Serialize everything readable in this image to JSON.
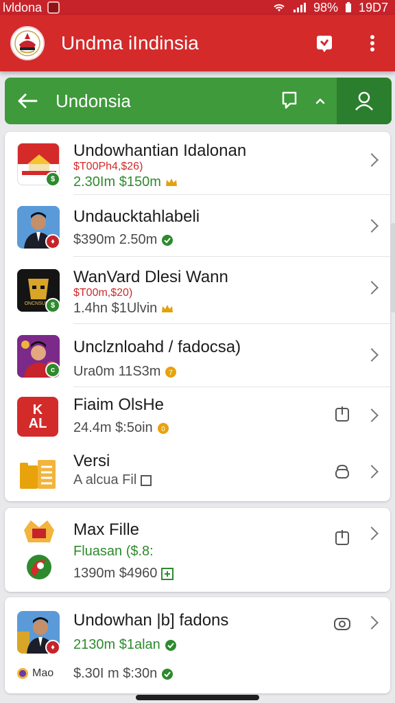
{
  "status": {
    "carrier": "lvldona",
    "battery": "98%",
    "time": "19D7"
  },
  "appbar": {
    "title": "Undma iIndinsia",
    "logo_icon": "emblem-logo-icon"
  },
  "search": {
    "value": "Undonsia"
  },
  "colors": {
    "primary_red": "#d42a2a",
    "green": "#3e9a3a",
    "dark_green": "#2b7e2d"
  },
  "list": [
    {
      "title": "Undowhantian Idalonan",
      "sub": "$T00Ph4,$26)",
      "meta": "2.30Im $150m",
      "meta_color": "green"
    },
    {
      "title": "Undaucktahlabeli",
      "sub": "",
      "meta": "$390m 2.50m",
      "meta_color": "green"
    },
    {
      "title": "WanVard Dlesi Wann",
      "sub": "$T00m,$20)",
      "meta": "1.4hn $1Ulvin",
      "meta_color": "orange"
    },
    {
      "title": "Unclznloahd / fadocsa)",
      "sub": "",
      "meta": "Ura0m 11S3m",
      "meta_color": "orange"
    },
    {
      "title": "Fiaim OlsHe",
      "sub": "",
      "meta": "24.4m $:5oin",
      "meta_color": "green",
      "thumb_text": [
        "K",
        "AL"
      ]
    },
    {
      "title": "Versi",
      "sub": "",
      "meta": "A alcua Fil"
    }
  ],
  "card2": {
    "title": "Max Fille",
    "sub": "Fluasan ($.8:",
    "meta": "1390m $4960"
  },
  "card3": {
    "title": "Undowhan |b] fadons",
    "line2": "2130m $1alan",
    "line3": "$.30I m $:30n",
    "footer_label": "Mao"
  }
}
